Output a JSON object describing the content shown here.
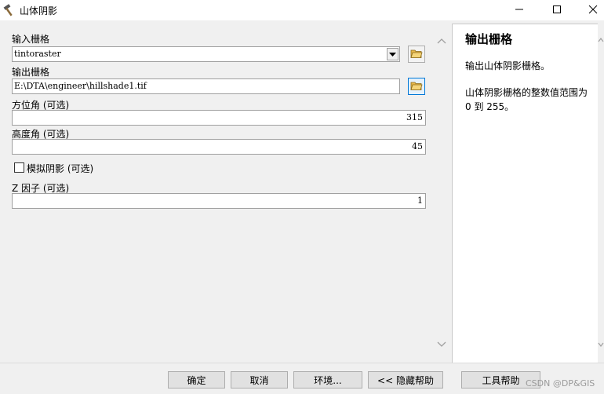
{
  "window": {
    "title": "山体阴影",
    "app_icon": "hammer-icon",
    "controls": [
      "minimize-icon",
      "maximize-icon",
      "close-icon"
    ]
  },
  "form": {
    "input_raster": {
      "label": "输入栅格",
      "value": "tintoraster"
    },
    "output_raster": {
      "label": "输出栅格",
      "value": "E:\\DTA\\engineer\\hillshade1.tif"
    },
    "azimuth": {
      "label": "方位角 (可选)",
      "value": "315"
    },
    "altitude": {
      "label": "高度角 (可选)",
      "value": "45"
    },
    "model_shadows": {
      "label": "模拟阴影 (可选)",
      "checked": false
    },
    "z_factor": {
      "label": "Z 因子 (可选)",
      "value": "1"
    }
  },
  "help": {
    "title": "输出栅格",
    "paragraph1": "输出山体阴影栅格。",
    "paragraph2": "山体阴影栅格的整数值范围为 0 到 255。"
  },
  "buttons": {
    "ok": "确定",
    "cancel": "取消",
    "environments": "环境...",
    "hide_help": "<< 隐藏帮助",
    "tool_help": "工具帮助"
  },
  "watermark": "CSDN @DP&GIS",
  "colors": {
    "focus_border": "#0078d7",
    "folder_yellow": "#e8b84a"
  }
}
